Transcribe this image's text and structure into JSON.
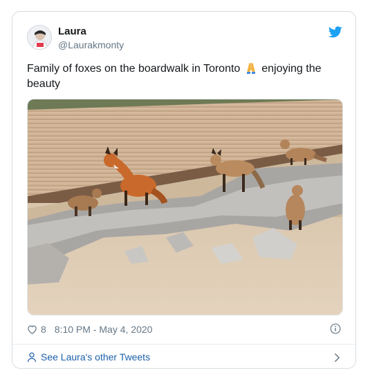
{
  "tweet": {
    "author_name": "Laura",
    "author_handle": "@Laurakmonty",
    "text_before_emoji": "Family of foxes on the boardwalk in Toronto",
    "text_after_emoji": "enjoying the beauty",
    "emoji": "folded-hands",
    "like_count": "8",
    "timestamp": "8:10 PM - May 4, 2020",
    "media_description_icon": "fox-family-photo"
  },
  "footer": {
    "link_label": "See Laura's other Tweets"
  },
  "colors": {
    "twitter_blue": "#1da1f2",
    "link_blue": "#1b5fa8",
    "muted_gray": "#657786",
    "border": "#d6dde3"
  }
}
